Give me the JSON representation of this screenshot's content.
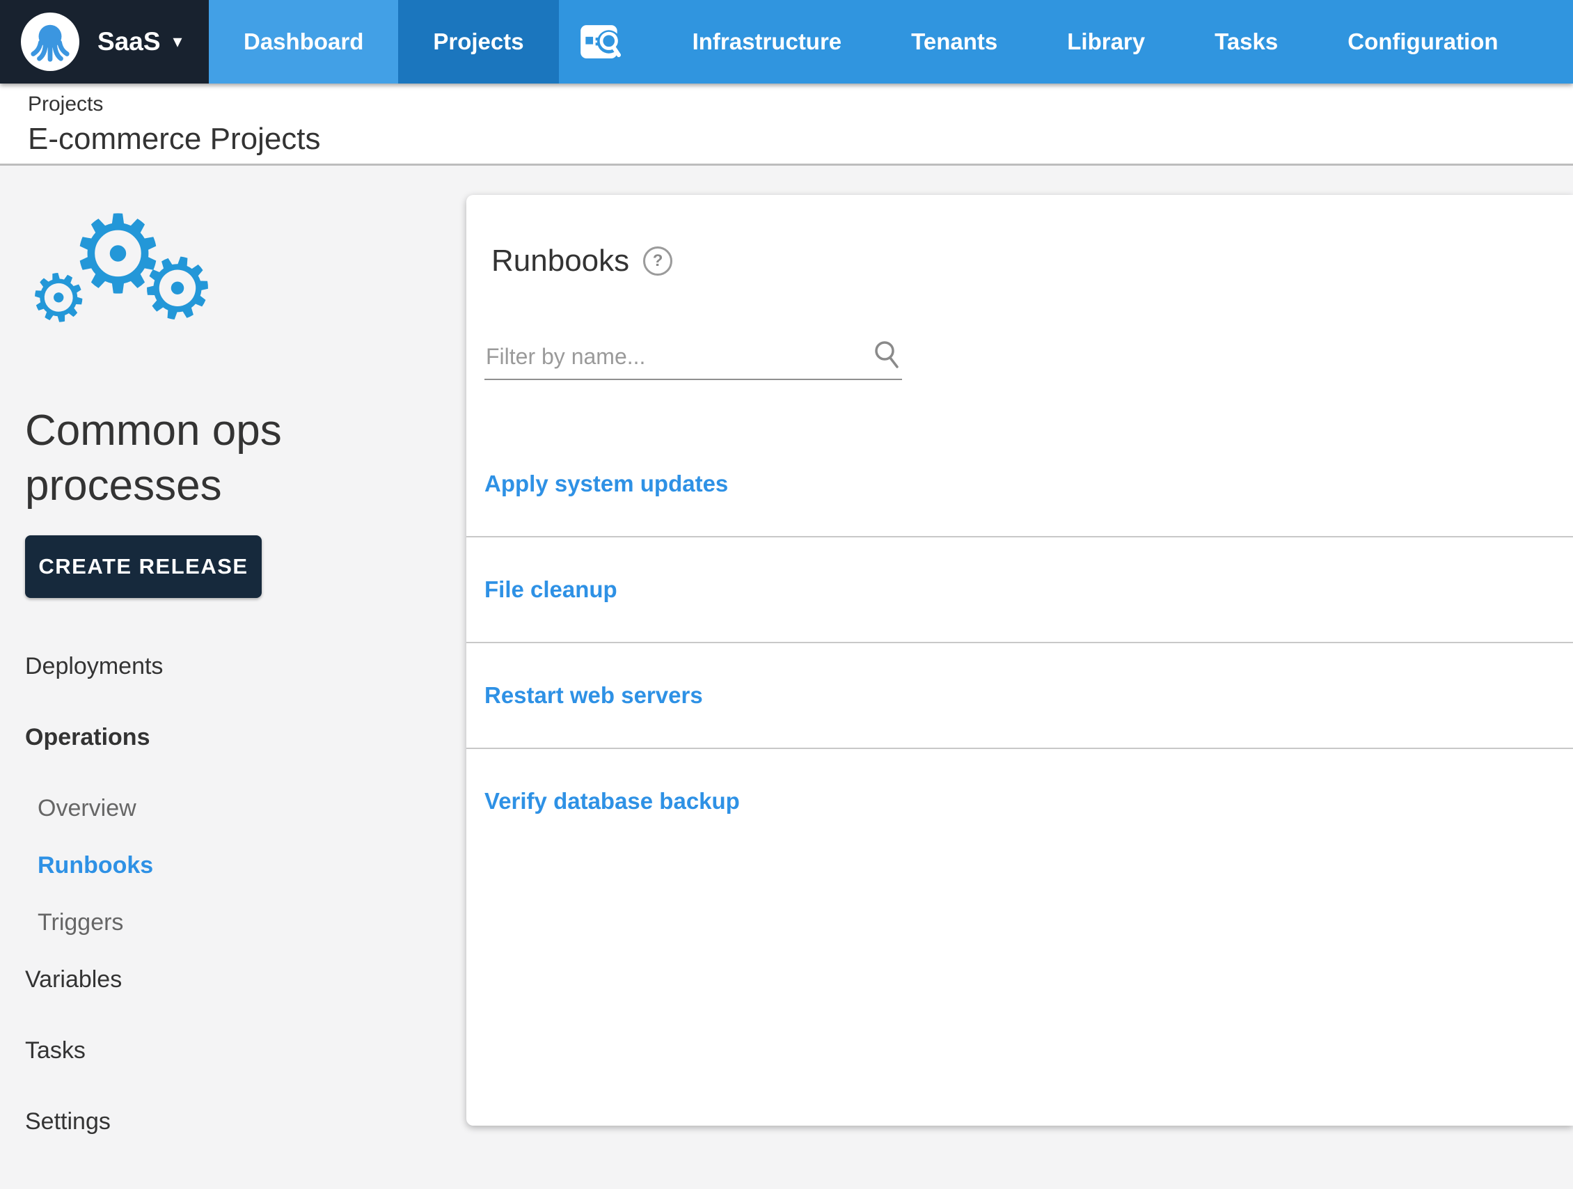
{
  "nav": {
    "brand": "SaaS",
    "items": [
      "Dashboard",
      "Projects",
      "Infrastructure",
      "Tenants",
      "Library",
      "Tasks",
      "Configuration"
    ],
    "active_item": "Projects"
  },
  "breadcrumb": {
    "section": "Projects",
    "title": "E-commerce Projects"
  },
  "sidebar": {
    "title": "Common ops processes",
    "create_release_label": "CREATE RELEASE",
    "menu": [
      {
        "label": "Deployments"
      },
      {
        "label": "Operations"
      },
      {
        "label": "Overview"
      },
      {
        "label": "Runbooks"
      },
      {
        "label": "Triggers"
      },
      {
        "label": "Variables"
      },
      {
        "label": "Tasks"
      },
      {
        "label": "Settings"
      }
    ],
    "active_menu_item": "Runbooks"
  },
  "main": {
    "heading": "Runbooks",
    "filter": {
      "placeholder": "Filter by name..."
    },
    "runbooks": [
      {
        "name": "Apply system updates"
      },
      {
        "name": "File cleanup"
      },
      {
        "name": "Restart web servers"
      },
      {
        "name": "Verify database backup"
      }
    ]
  },
  "icons": {
    "brand": "octopus-icon",
    "brand_caret": "chevron-down-icon",
    "nav_search": "search-icon",
    "project_logo": "gears-icon",
    "heading_help": "help-icon",
    "filter_search": "search-icon"
  },
  "colors": {
    "nav_blue": "#3095DF",
    "nav_tab_light": "#42A0E6",
    "nav_tab_active": "#1B76BE",
    "brand_dark": "#18222F",
    "accent_blue": "#2E91E5",
    "button_dark": "#16293C",
    "page_bg": "#F4F4F5",
    "muted_text": "#666666",
    "placeholder_text": "#9A9A9A"
  }
}
